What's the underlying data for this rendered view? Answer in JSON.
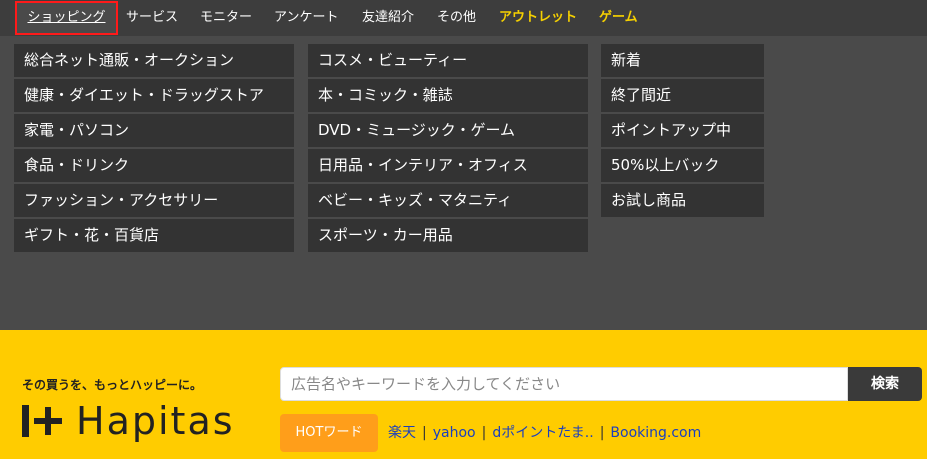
{
  "nav": [
    {
      "label": "ショッピング",
      "active": true
    },
    {
      "label": "サービス"
    },
    {
      "label": "モニター"
    },
    {
      "label": "アンケート"
    },
    {
      "label": "友達紹介"
    },
    {
      "label": "その他"
    },
    {
      "label": "アウトレット",
      "highlight": true
    },
    {
      "label": "ゲーム",
      "highlight": true
    }
  ],
  "menu": {
    "col1": [
      "総合ネット通販・オークション",
      "健康・ダイエット・ドラッグストア",
      "家電・パソコン",
      "食品・ドリンク",
      "ファッション・アクセサリー",
      "ギフト・花・百貨店"
    ],
    "col2": [
      "コスメ・ビューティー",
      "本・コミック・雑誌",
      "DVD・ミュージック・ゲーム",
      "日用品・インテリア・オフィス",
      "ベビー・キッズ・マタニティ",
      "スポーツ・カー用品"
    ],
    "col3": [
      "新着",
      "終了間近",
      "ポイントアップ中",
      "50%以上バック",
      "お試し商品"
    ]
  },
  "footer": {
    "tagline": "その買うを、もっとハッピーに。",
    "logo_text": "Hapitas",
    "search_placeholder": "広告名やキーワードを入力してください",
    "search_button": "検索",
    "hot_label": "HOTワード",
    "hot_words": [
      "楽天",
      "yahoo",
      "dポイントたま..",
      "Booking.com"
    ],
    "separator": "|"
  },
  "colors": {
    "accent_yellow": "#ffcc00",
    "nav_highlight": "#f5d000",
    "active_border": "#ff1a1a",
    "hot_badge": "#ff9e1a",
    "link": "#1a3fbf"
  }
}
